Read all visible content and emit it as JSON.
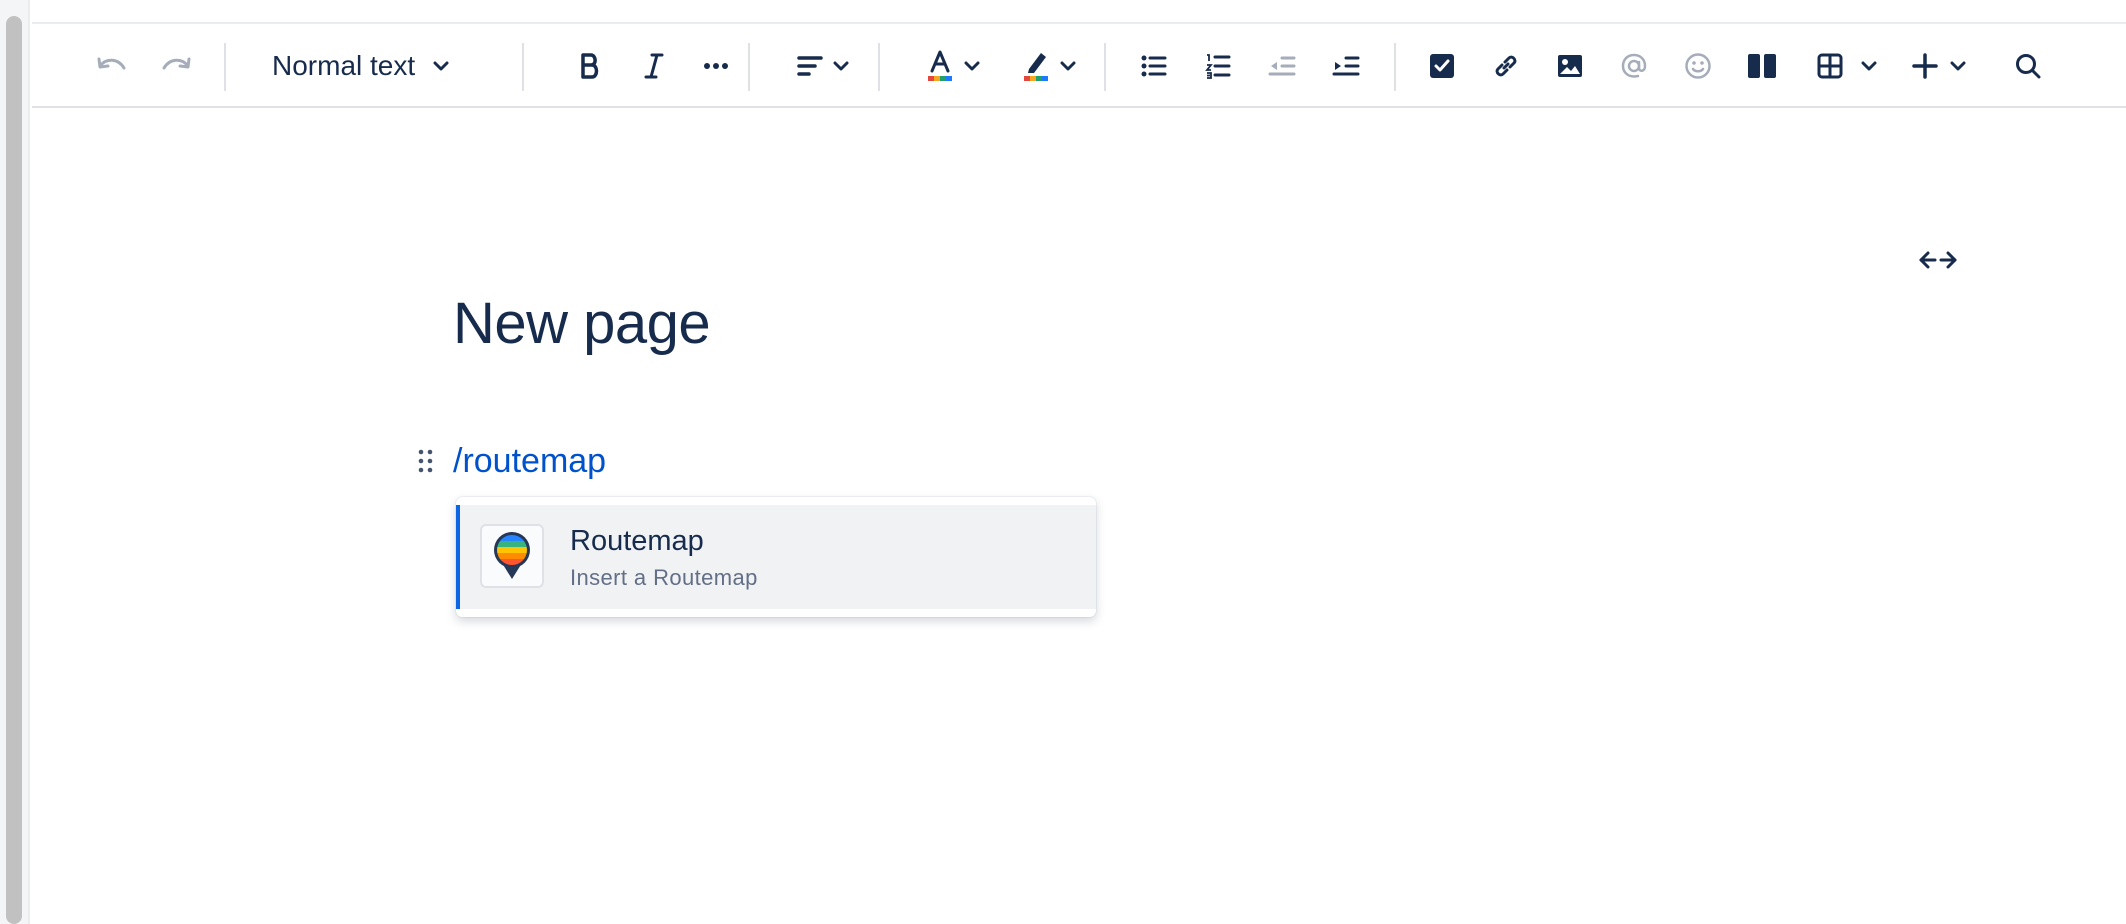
{
  "toolbar": {
    "text_style": "Normal text",
    "items": [
      "undo",
      "redo",
      "bold",
      "italic",
      "more-formatting",
      "text-alignment",
      "text-color",
      "highlight",
      "bullet-list",
      "numbered-list",
      "outdent",
      "indent",
      "action-item",
      "link",
      "image",
      "mention",
      "emoji",
      "layouts",
      "table",
      "insert",
      "find"
    ]
  },
  "page": {
    "title": "New page",
    "slash_command": "/routemap"
  },
  "typeahead": {
    "items": [
      {
        "title": "Routemap",
        "description": "Insert a Routemap",
        "icon": "routemap-pin-icon"
      }
    ]
  },
  "colors": {
    "text": "#172b4d",
    "link": "#0052cc",
    "selected_accent": "#0c66e4",
    "disabled_icon": "#a5adba"
  }
}
